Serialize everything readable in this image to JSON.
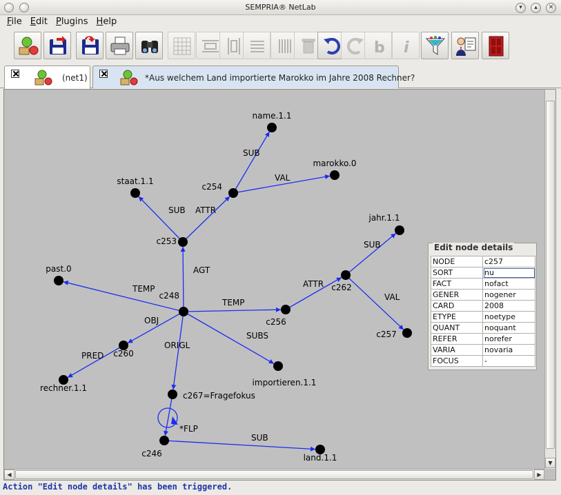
{
  "window": {
    "title": "SEMPRIA® NetLab"
  },
  "menu": [
    {
      "label": "File",
      "mnemonic": "F",
      "rest": "ile"
    },
    {
      "label": "Edit",
      "mnemonic": "E",
      "rest": "dit"
    },
    {
      "label": "Plugins",
      "mnemonic": "P",
      "rest": "lugins"
    },
    {
      "label": "Help",
      "mnemonic": "H",
      "rest": "elp"
    }
  ],
  "tabs": [
    {
      "label": "(net1)"
    },
    {
      "label": "*Aus welchem Land importierte Marokko im Jahre 2008 Rechner?"
    }
  ],
  "status": "Action \"Edit node details\" has been triggered.",
  "details": {
    "title": "Edit node details",
    "rows": [
      {
        "key": "NODE",
        "value": "c257"
      },
      {
        "key": "SORT",
        "value": "nu"
      },
      {
        "key": "FACT",
        "value": "nofact"
      },
      {
        "key": "GENER",
        "value": "nogener"
      },
      {
        "key": "CARD",
        "value": "2008"
      },
      {
        "key": "ETYPE",
        "value": "noetype"
      },
      {
        "key": "QUANT",
        "value": "noquant"
      },
      {
        "key": "REFER",
        "value": "norefer"
      },
      {
        "key": "VARIA",
        "value": "novaria"
      },
      {
        "key": "FOCUS",
        "value": "-"
      }
    ]
  },
  "graph": {
    "nodes": [
      {
        "id": "name",
        "label": "name.1.1"
      },
      {
        "id": "marokko",
        "label": "marokko.0"
      },
      {
        "id": "staat",
        "label": "staat.1.1"
      },
      {
        "id": "c254",
        "label": "c254"
      },
      {
        "id": "c253",
        "label": "c253"
      },
      {
        "id": "jahr",
        "label": "jahr.1.1"
      },
      {
        "id": "c262",
        "label": "c262"
      },
      {
        "id": "past",
        "label": "past.0"
      },
      {
        "id": "c248",
        "label": "c248"
      },
      {
        "id": "c256",
        "label": "c256"
      },
      {
        "id": "c257",
        "label": "c257"
      },
      {
        "id": "c260",
        "label": "c260"
      },
      {
        "id": "rechner",
        "label": "rechner.1.1"
      },
      {
        "id": "importieren",
        "label": "importieren.1.1"
      },
      {
        "id": "c267",
        "label": "c267=Fragefokus"
      },
      {
        "id": "c246",
        "label": "c246"
      },
      {
        "id": "land",
        "label": "land.1.1"
      }
    ],
    "edges": [
      {
        "from": "c254",
        "to": "name",
        "label": "SUB"
      },
      {
        "from": "c254",
        "to": "marokko",
        "label": "VAL"
      },
      {
        "from": "c253",
        "to": "staat",
        "label": "SUB"
      },
      {
        "from": "c253",
        "to": "c254",
        "label": "ATTR"
      },
      {
        "from": "c248",
        "to": "c253",
        "label": "AGT"
      },
      {
        "from": "c262",
        "to": "jahr",
        "label": "SUB"
      },
      {
        "from": "c262",
        "to": "c257",
        "label": "VAL"
      },
      {
        "from": "c256",
        "to": "c262",
        "label": "ATTR"
      },
      {
        "from": "c248",
        "to": "past",
        "label": "TEMP"
      },
      {
        "from": "c248",
        "to": "c256",
        "label": "TEMP"
      },
      {
        "from": "c248",
        "to": "c260",
        "label": "OBJ"
      },
      {
        "from": "c260",
        "to": "rechner",
        "label": "PRED"
      },
      {
        "from": "c248",
        "to": "importieren",
        "label": "SUBS"
      },
      {
        "from": "c248",
        "to": "c267",
        "label": "ORIGL"
      },
      {
        "from": "c246",
        "to": "land",
        "label": "SUB"
      },
      {
        "from": "c267",
        "to": "c246",
        "label": "*FLP"
      }
    ]
  },
  "colors": {
    "edge": "#1b2cf0",
    "node": "#000000",
    "canvas": "#c0c0c0",
    "status": "#1f34a8"
  }
}
